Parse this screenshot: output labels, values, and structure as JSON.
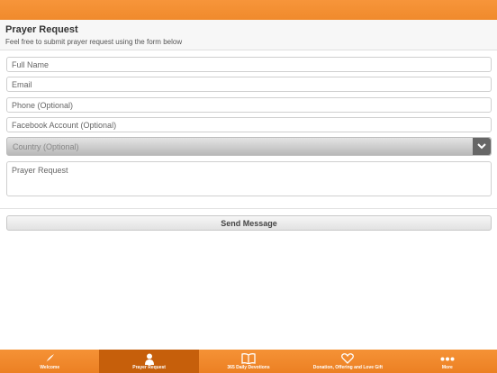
{
  "header": {
    "title": "Prayer Request",
    "subtitle": "Feel free to submit prayer request using the form below"
  },
  "form": {
    "full_name_placeholder": "Full Name",
    "email_placeholder": "Email",
    "phone_placeholder": "Phone (Optional)",
    "facebook_placeholder": "Facebook Account (Optional)",
    "country_selected": "Country (Optional)",
    "prayer_request_placeholder": "Prayer Request",
    "send_label": "Send Message"
  },
  "tabs": [
    {
      "label": "Welcome",
      "icon": "quill-icon",
      "active": false
    },
    {
      "label": "Prayer Request",
      "icon": "person-icon",
      "active": true
    },
    {
      "label": "365 Daily Devotions",
      "icon": "book-icon",
      "active": false
    },
    {
      "label": "Donation, Offering and Love Gift",
      "icon": "heart-icon",
      "active": false
    },
    {
      "label": "More",
      "icon": "dots-icon",
      "active": false
    }
  ],
  "colors": {
    "accent": "#f08a2c",
    "active_tab": "#c65f0b"
  }
}
